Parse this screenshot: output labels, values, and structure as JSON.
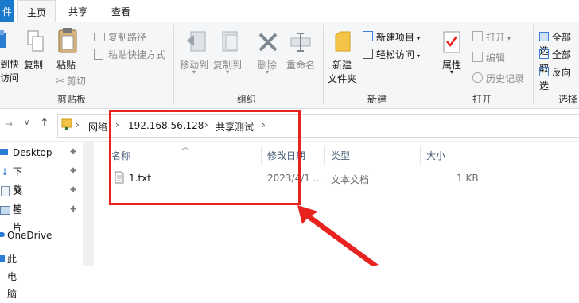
{
  "tabs": {
    "file": "件",
    "home": "主页",
    "share": "共享",
    "view": "查看"
  },
  "ribbon": {
    "clipboard": {
      "pin_quick_line1": "到快",
      "pin_quick_line2": "访问",
      "copy": "复制",
      "paste": "粘贴",
      "copy_path": "复制路径",
      "paste_shortcut": "粘贴快捷方式",
      "cut": "剪切",
      "label": "剪贴板"
    },
    "organize": {
      "move_to": "移动到",
      "copy_to": "复制到",
      "delete": "删除",
      "rename": "重命名",
      "label": "组织"
    },
    "new": {
      "new_folder_line1": "新建",
      "new_folder_line2": "文件夹",
      "new_item": "新建项目",
      "easy_access": "轻松访问",
      "label": "新建"
    },
    "open": {
      "properties": "属性",
      "open": "打开",
      "edit": "编辑",
      "history": "历史记录",
      "label": "打开"
    },
    "select": {
      "select_all": "全部选",
      "select_none": "全部取",
      "invert": "反向选",
      "label": "选择"
    }
  },
  "address": {
    "crumbs": [
      "网络",
      "192.168.56.128",
      "共享测试"
    ]
  },
  "sidebar": {
    "items": [
      "Desktop",
      "下载",
      "文档",
      "图片",
      "OneDrive",
      "此电脑"
    ]
  },
  "columns": {
    "name": "名称",
    "date": "修改日期",
    "type": "类型",
    "size": "大小"
  },
  "files": [
    {
      "name": "1.txt",
      "date": "2023/4/1 …",
      "type": "文本文档",
      "size": "1 KB"
    }
  ],
  "colors": {
    "accent": "#1979ca",
    "highlight": "#e8231f"
  }
}
